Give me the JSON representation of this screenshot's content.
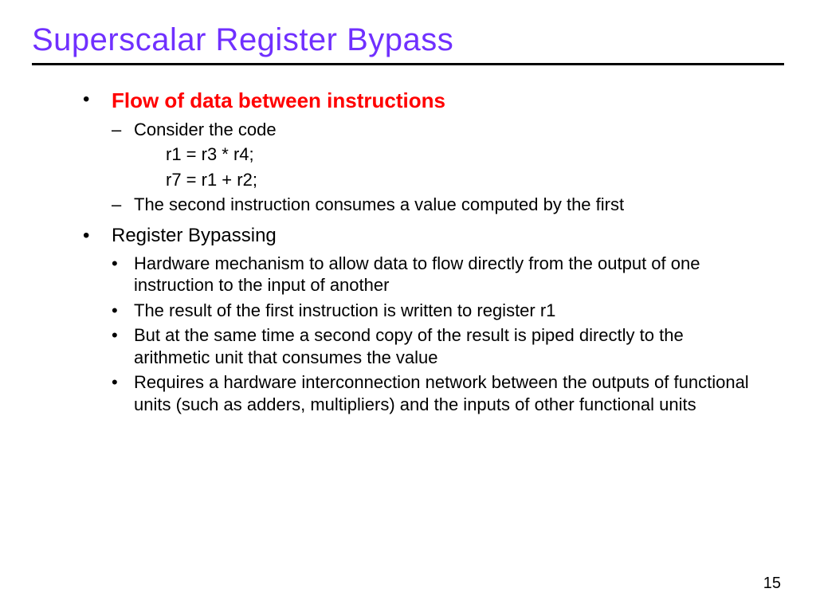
{
  "title": "Superscalar Register Bypass",
  "page_number": "15",
  "section1": {
    "heading": "Flow of data between instructions",
    "sub1": "Consider the code",
    "code1": "r1 = r3 * r4;",
    "code2": "r7 = r1 + r2;",
    "sub2": "The second instruction consumes a value computed by the first"
  },
  "section2": {
    "heading": "Register Bypassing",
    "p1": "Hardware mechanism to allow data to flow directly from the output of one instruction to the input of another",
    "p2": "The result of the first instruction is written to register r1",
    "p3": "But at the same time a second copy of the result is piped directly to the arithmetic unit that consumes the value",
    "p4": "Requires a hardware interconnection network between the outputs of functional units (such as adders, multipliers) and the inputs of other functional units"
  }
}
